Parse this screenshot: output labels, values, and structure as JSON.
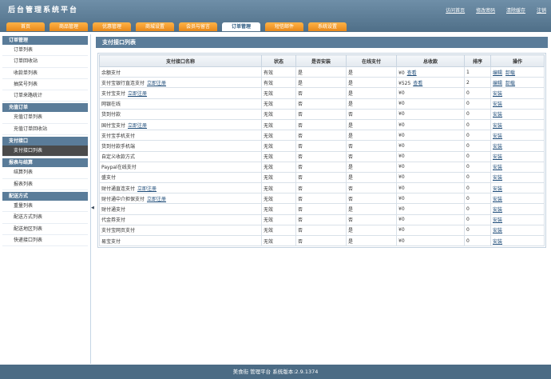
{
  "header": {
    "title": "后台管理系统平台",
    "links": [
      "访问首页",
      "修改密码",
      "清除缓存",
      "注销"
    ]
  },
  "nav": {
    "tabs": [
      "首页",
      "商品管理",
      "优惠管理",
      "商城设置",
      "会员与留言",
      "订单管理",
      "短信邮件",
      "系统设置"
    ],
    "active_index": 5
  },
  "sidebar": {
    "groups": [
      {
        "title": "订单管理",
        "items": [
          "订单列表",
          "订单回收站",
          "收款单列表",
          "抽奖号列表",
          "订单来路统计"
        ]
      },
      {
        "title": "充值订单",
        "items": [
          "充值订单列表",
          "充值订单回收站"
        ]
      },
      {
        "title": "支付接口",
        "items": [
          "支付接口列表"
        ]
      },
      {
        "title": "报表与结算",
        "items": [
          "结算列表",
          "报表列表"
        ]
      },
      {
        "title": "配送方式",
        "items": [
          "重量列表",
          "配送方式列表",
          "配送地区列表",
          "快递接口列表"
        ]
      }
    ],
    "active_item": "支付接口列表"
  },
  "main": {
    "title": "支付接口列表",
    "columns": [
      "支付接口名称",
      "状态",
      "是否安装",
      "在线支付",
      "总收款",
      "排序",
      "操作"
    ],
    "rows": [
      {
        "name": "余额支付",
        "reg": "",
        "status": "有效",
        "installed": "是",
        "online": "是",
        "total": "¥0",
        "view": "查看",
        "sort": "1",
        "ops": [
          "编辑",
          "卸载"
        ]
      },
      {
        "name": "支付宝银行直连支付",
        "reg": "立即注册",
        "status": "有效",
        "installed": "是",
        "online": "是",
        "total": "¥525",
        "view": "查看",
        "sort": "2",
        "ops": [
          "编辑",
          "卸载"
        ]
      },
      {
        "name": "支付宝支付",
        "reg": "立即注册",
        "status": "无效",
        "installed": "否",
        "online": "是",
        "total": "¥0",
        "view": "",
        "sort": "0",
        "ops": [
          "安装"
        ]
      },
      {
        "name": "网银在线",
        "reg": "",
        "status": "无效",
        "installed": "否",
        "online": "是",
        "total": "¥0",
        "view": "",
        "sort": "0",
        "ops": [
          "安装"
        ]
      },
      {
        "name": "货到付款",
        "reg": "",
        "status": "无效",
        "installed": "否",
        "online": "否",
        "total": "¥0",
        "view": "",
        "sort": "0",
        "ops": [
          "安装"
        ]
      },
      {
        "name": "国付宝支付",
        "reg": "立即注册",
        "status": "无效",
        "installed": "否",
        "online": "是",
        "total": "¥0",
        "view": "",
        "sort": "0",
        "ops": [
          "安装"
        ]
      },
      {
        "name": "支付宝手机支付",
        "reg": "",
        "status": "无效",
        "installed": "否",
        "online": "是",
        "total": "¥0",
        "view": "",
        "sort": "0",
        "ops": [
          "安装"
        ]
      },
      {
        "name": "货到付款手机端",
        "reg": "",
        "status": "无效",
        "installed": "否",
        "online": "否",
        "total": "¥0",
        "view": "",
        "sort": "0",
        "ops": [
          "安装"
        ]
      },
      {
        "name": "自定义收款方式",
        "reg": "",
        "status": "无效",
        "installed": "否",
        "online": "否",
        "total": "¥0",
        "view": "",
        "sort": "0",
        "ops": [
          "安装"
        ]
      },
      {
        "name": "Paypal在线支付",
        "reg": "",
        "status": "无效",
        "installed": "否",
        "online": "是",
        "total": "¥0",
        "view": "",
        "sort": "0",
        "ops": [
          "安装"
        ]
      },
      {
        "name": "盛支付",
        "reg": "",
        "status": "无效",
        "installed": "否",
        "online": "是",
        "total": "¥0",
        "view": "",
        "sort": "0",
        "ops": [
          "安装"
        ]
      },
      {
        "name": "财付通直连支付",
        "reg": "立即注册",
        "status": "无效",
        "installed": "否",
        "online": "否",
        "total": "¥0",
        "view": "",
        "sort": "0",
        "ops": [
          "安装"
        ]
      },
      {
        "name": "财付通中介担保支付",
        "reg": "立即注册",
        "status": "无效",
        "installed": "否",
        "online": "否",
        "total": "¥0",
        "view": "",
        "sort": "0",
        "ops": [
          "安装"
        ]
      },
      {
        "name": "财付通支付",
        "reg": "",
        "status": "无效",
        "installed": "否",
        "online": "是",
        "total": "¥0",
        "view": "",
        "sort": "0",
        "ops": [
          "安装"
        ]
      },
      {
        "name": "代金券支付",
        "reg": "",
        "status": "无效",
        "installed": "否",
        "online": "否",
        "total": "¥0",
        "view": "",
        "sort": "0",
        "ops": [
          "安装"
        ]
      },
      {
        "name": "支付宝网页支付",
        "reg": "",
        "status": "无效",
        "installed": "否",
        "online": "是",
        "total": "¥0",
        "view": "",
        "sort": "0",
        "ops": [
          "安装"
        ]
      },
      {
        "name": "易宝支付",
        "reg": "",
        "status": "无效",
        "installed": "否",
        "online": "是",
        "total": "¥0",
        "view": "",
        "sort": "0",
        "ops": [
          "安装"
        ]
      }
    ]
  },
  "footer": {
    "text": "美食街 管理平台 系统版本:2.9.1374"
  },
  "colors": {
    "header": "#5f7f98",
    "nav_tab": "#f5a030",
    "sidebar_head": "#5a7c99",
    "footer": "#4c6c85",
    "link": "#1f4d7a"
  }
}
